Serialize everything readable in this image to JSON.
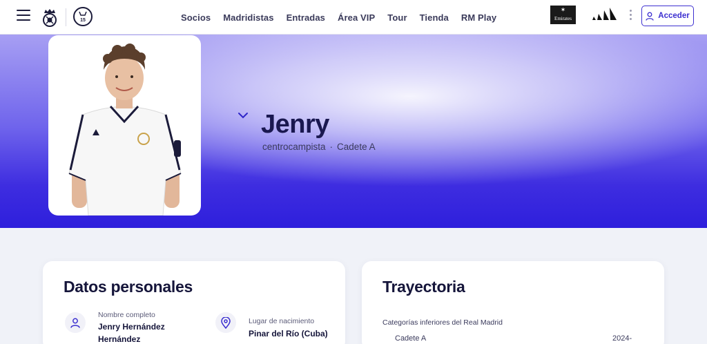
{
  "header": {
    "nav": [
      "Socios",
      "Madridistas",
      "Entradas",
      "Área VIP",
      "Tour",
      "Tienda",
      "RM Play"
    ],
    "sponsor_emirates": "Emirates",
    "login_label": "Acceder"
  },
  "hero": {
    "name": "Jenry",
    "position": "centrocampista",
    "team": "Cadete A",
    "separator": "·"
  },
  "personal": {
    "title": "Datos personales",
    "full_name_label": "Nombre completo",
    "full_name_line1": "Jenry Hernández",
    "full_name_line2": "Hernández",
    "birthplace_label": "Lugar de nacimiento",
    "birthplace": "Pinar del Río (Cuba)"
  },
  "career": {
    "title": "Trayectoria",
    "section": "Categorías inferiores del Real Madrid",
    "rows": [
      {
        "name": "Cadete A",
        "years": "2024-"
      }
    ]
  },
  "colors": {
    "accent": "#3c2fd0",
    "hero_dark": "#2e1fdc",
    "hero_light": "#a79ff3",
    "text_dark": "#1a1850"
  }
}
